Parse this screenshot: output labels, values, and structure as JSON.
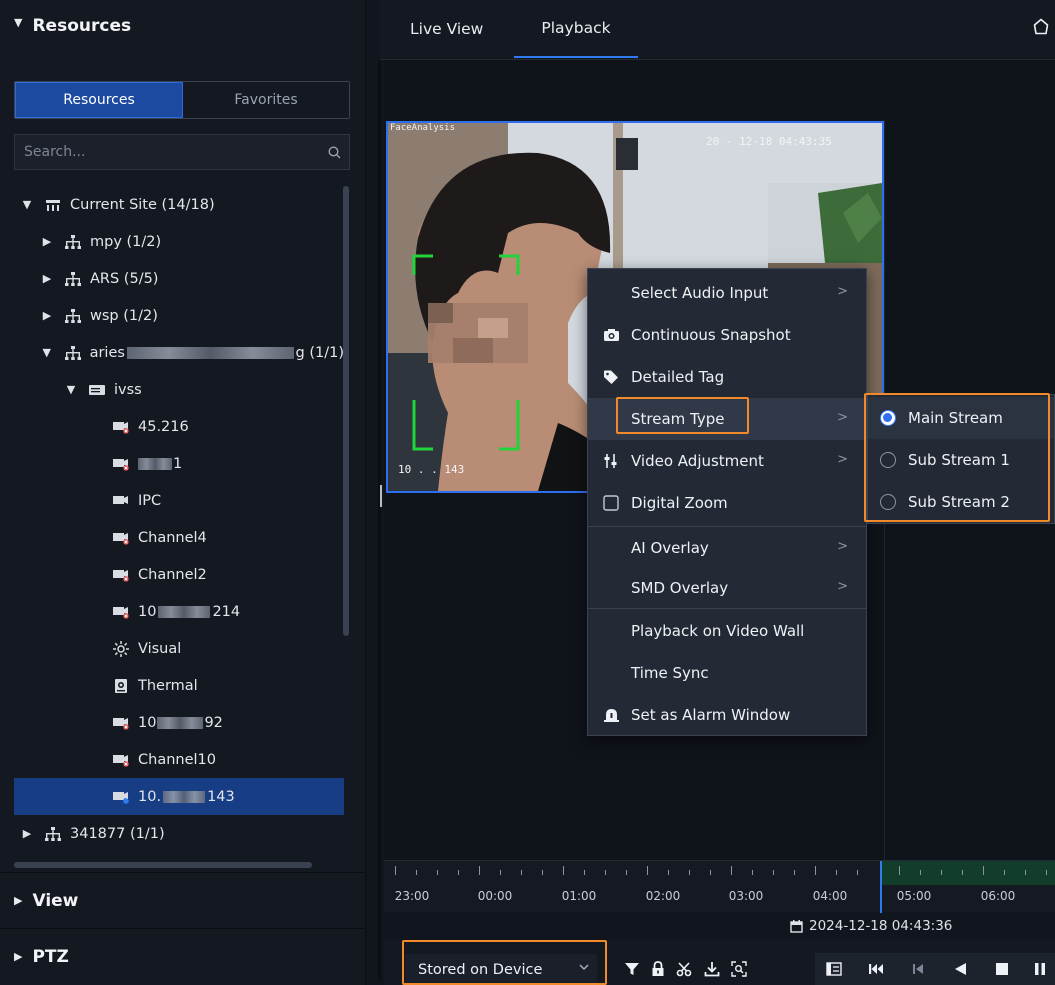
{
  "left_panel": {
    "resources_header": "Resources",
    "tabs": {
      "resources": "Resources",
      "favorites": "Favorites"
    },
    "search": {
      "placeholder": "Search..."
    },
    "tree": [
      {
        "label": "Current Site (14/18)"
      },
      {
        "label": "mpy (1/2)"
      },
      {
        "label": "ARS (5/5)"
      },
      {
        "label": "wsp (1/2)"
      },
      {
        "label_prefix": "aries",
        "label_suffix": "g (1/1)"
      },
      {
        "label": "ivss"
      },
      {
        "label": "45.216"
      },
      {
        "label": "1"
      },
      {
        "label": "IPC"
      },
      {
        "label": "Channel4"
      },
      {
        "label": "Channel2"
      },
      {
        "label_prefix": "10",
        "label_suffix": "214"
      },
      {
        "label": "Visual"
      },
      {
        "label": "Thermal"
      },
      {
        "label_prefix": "10",
        "label_suffix": "92"
      },
      {
        "label": "Channel10"
      },
      {
        "label_prefix": "10.",
        "label_suffix": "143"
      },
      {
        "label": "341877 (1/1)"
      }
    ],
    "view_header": "View",
    "ptz_header": "PTZ"
  },
  "top_tabs": {
    "live_view": "Live View",
    "playback": "Playback"
  },
  "video": {
    "osd_top_left": "FaceAnalysis",
    "osd_top_right": "20 - 12-18 04:43:35",
    "osd_bottom_left": "10 . . 143"
  },
  "context_menu": {
    "items": [
      {
        "label": "Select Audio Input"
      },
      {
        "label": "Continuous Snapshot"
      },
      {
        "label": "Detailed Tag"
      },
      {
        "label": "Stream Type"
      },
      {
        "label": "Video Adjustment"
      },
      {
        "label": "Digital Zoom"
      },
      {
        "label": "AI Overlay"
      },
      {
        "label": "SMD Overlay"
      },
      {
        "label": "Playback on Video Wall"
      },
      {
        "label": "Time Sync"
      },
      {
        "label": "Set as Alarm Window"
      }
    ],
    "stream_submenu": [
      {
        "label": "Main Stream",
        "selected": true
      },
      {
        "label": "Sub Stream 1",
        "selected": false
      },
      {
        "label": "Sub Stream 2",
        "selected": false
      }
    ]
  },
  "timeline": {
    "labels": [
      "23:00",
      "00:00",
      "01:00",
      "02:00",
      "03:00",
      "04:00",
      "05:00",
      "06:00"
    ],
    "current_datetime": "2024-12-18 04:43:36"
  },
  "playback_toolbar": {
    "source": "Stored on Device"
  },
  "colors": {
    "accent": "#2e7bf0",
    "highlight_box": "#f08a2a",
    "selected_row": "#173d85",
    "recording_bar": "#123d2a"
  }
}
